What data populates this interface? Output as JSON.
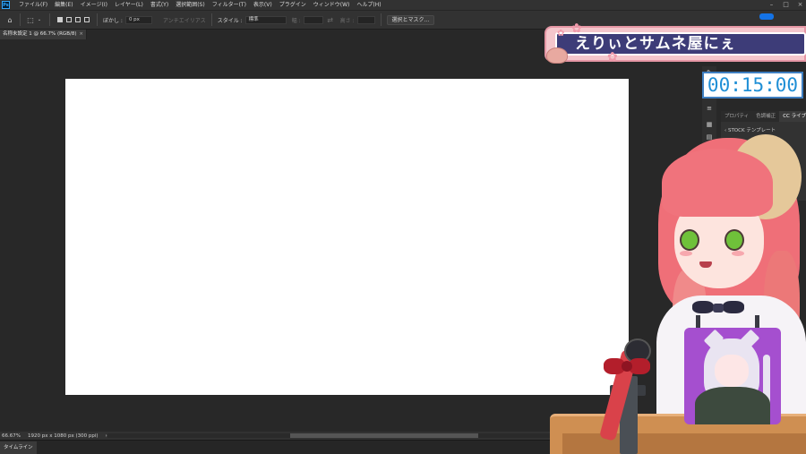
{
  "app": {
    "logo": "Ps",
    "menu": [
      "ファイル(F)",
      "編集(E)",
      "イメージ(I)",
      "レイヤー(L)",
      "書式(Y)",
      "選択範囲(S)",
      "フィルター(T)",
      "表示(V)",
      "プラグイン",
      "ウィンドウ(W)",
      "ヘルプ(H)"
    ]
  },
  "options": {
    "feather_label": "ぼかし :",
    "feather_value": "0 px",
    "antialias_label": "アンチエイリアス",
    "style_label": "スタイル :",
    "style_value": "標準",
    "width_label": "幅 :",
    "height_label": "高さ :",
    "mask_button": "選択とマスク..."
  },
  "document": {
    "tab_title": "名称未設定 1 @ 66.7% (RGB/8)",
    "close": "×"
  },
  "status": {
    "zoom": "66.67%",
    "size": "1920 px x 1080 px (300 ppi)",
    "arrow": "›",
    "scroll_left": "‹"
  },
  "timeline": {
    "tab": "タイムライン"
  },
  "panel": {
    "tabs": [
      "プロパティ",
      "色調補正",
      "CC ライブラリ"
    ],
    "breadcrumb": "‹ STOCK テンプレート",
    "dim_text": "アセット検索"
  },
  "overlay": {
    "title": "えりぃとサムネ屋にぇ",
    "timer": "00:15:00"
  },
  "colors": {
    "ps_bg": "#282828",
    "panel": "#323232",
    "accent_blue": "#1473e6",
    "timer_text": "#1f8fd6",
    "banner_navy": "#3d3c78",
    "banner_pink": "#f4c6cc"
  }
}
